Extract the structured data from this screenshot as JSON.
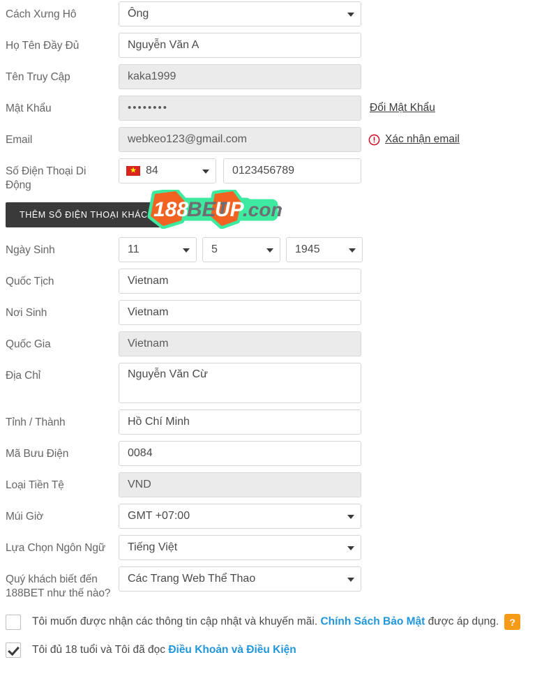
{
  "form": {
    "rows": [
      {
        "label": "Cách Xưng Hô",
        "type": "select",
        "value": "Ông",
        "name": "salutation"
      },
      {
        "label": "Họ Tên Đầy Đủ",
        "type": "text",
        "value": "Nguyễn Văn A",
        "name": "fullname"
      },
      {
        "label": "Tên Truy Cập",
        "type": "text-disabled",
        "value": "kaka1999",
        "name": "username"
      },
      {
        "label": "Mật Khẩu",
        "type": "password",
        "value": "••••••••",
        "name": "password",
        "side_link": "Đổi Mật Khẩu"
      },
      {
        "label": "Email",
        "type": "text-disabled",
        "value": "webkeo123@gmail.com",
        "name": "email",
        "side_link": "Xác nhận email",
        "side_icon": "warning-circle-icon"
      },
      {
        "label": "Số Điện Thoại Di Động",
        "type": "phone",
        "country_code": "84",
        "flag": "vietnam-flag-icon",
        "value": "0123456789",
        "name": "mobile-phone"
      },
      {
        "label": "",
        "type": "button",
        "value": "THÊM SỐ ĐIỆN THOẠI KHÁC",
        "name": "add-other-phone"
      },
      {
        "label": "Ngày Sinh",
        "type": "dob",
        "day": "11",
        "month": "5",
        "year": "1945",
        "name": "date-of-birth"
      },
      {
        "label": "Quốc Tịch",
        "type": "text",
        "value": "Vietnam",
        "name": "nationality"
      },
      {
        "label": "Nơi Sinh",
        "type": "text",
        "value": "Vietnam",
        "name": "place-of-birth"
      },
      {
        "label": "Quốc Gia",
        "type": "text-disabled",
        "value": "Vietnam",
        "name": "country"
      },
      {
        "label": "Địa Chỉ",
        "type": "textarea",
        "value": "Nguyễn Văn Cừ",
        "name": "address"
      },
      {
        "label": "Tỉnh / Thành",
        "type": "text",
        "value": "Hồ Chí Minh",
        "name": "province-city"
      },
      {
        "label": "Mã Bưu Điện",
        "type": "text",
        "value": "0084",
        "name": "postal-code"
      },
      {
        "label": "Loại Tiền Tệ",
        "type": "text-disabled",
        "value": "VND",
        "name": "currency"
      },
      {
        "label": "Múi Giờ",
        "type": "select",
        "value": "GMT +07:00",
        "name": "timezone"
      },
      {
        "label": "Lựa Chọn Ngôn Ngữ",
        "type": "select",
        "value": "Tiếng Việt",
        "name": "language"
      },
      {
        "label": "Quý khách biết đến 188BET như thế nào?",
        "type": "select",
        "value": "Các Trang Web Thể Thao",
        "name": "referral-source"
      }
    ]
  },
  "agreements": {
    "promo": {
      "checked": false,
      "text_before": "Tôi muốn được nhận các thông tin cập nhật và khuyến mãi. ",
      "link": "Chính Sách Bảo Mật",
      "text_after": " được áp dụng.",
      "help_badge": "?"
    },
    "terms": {
      "checked": true,
      "text_before": "Tôi đủ 18 tuổi và Tôi đã đọc ",
      "link": "Điều Khoản và Điều Kiện",
      "text_after": ""
    }
  },
  "watermark": {
    "part1": "188",
    "part2": "BET",
    "part3": "UP",
    "part4": ".com"
  },
  "colors": {
    "label": "#666666",
    "field_border": "#d6d6d6",
    "field_disabled_bg": "#ebebeb",
    "button_dark": "#3a3a3a",
    "link_blue": "#2196da",
    "warning_red": "#d0021b",
    "badge_orange": "#f59b18",
    "watermark_orange": "#f26322",
    "watermark_green": "#3ee9a0",
    "watermark_gray": "#6d6e71"
  }
}
